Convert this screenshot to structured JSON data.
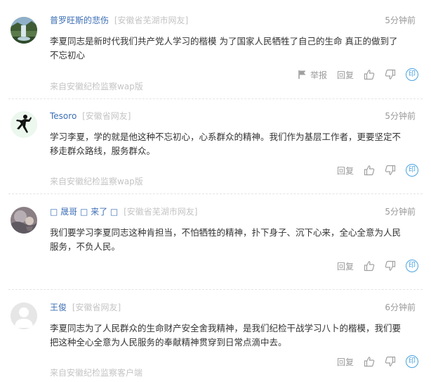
{
  "comments": [
    {
      "username": "普罗旺斯的悲伤",
      "location": "[安徽省芜湖市网友]",
      "time": "5分钟前",
      "lines": [
        "李夏同志是新时代我们共产党人学习的楷模 为了国家人民牺牲了自己的生命 真正的做到了",
        "不忘初心"
      ],
      "report_label": "举报",
      "reply_label": "回复",
      "share_label": "印",
      "source": "来自安徽纪检监察wap版",
      "avatar": "waterfall-landscape"
    },
    {
      "username": "Tesoro",
      "location": "[安徽省网友]",
      "time": "5分钟前",
      "lines": [
        "学习李夏，学的就是他这种不忘初心，心系群众的精神。我们作为基层工作者，更要坚定不",
        "移走群众路线，服务群众。"
      ],
      "reply_label": "回复",
      "share_label": "印",
      "source": "来自安徽纪检监察wap版",
      "avatar": "basketball-silhouette"
    },
    {
      "username": "□ 晟哥 □ 来了 □",
      "location": "[安徽省芜湖市网友]",
      "time": "5分钟前",
      "lines": [
        "我们要学习李夏同志这种肯担当，不怕牺牲的精神，扑下身子、沉下心来，全心全意为人民",
        "服务，不负人民。"
      ],
      "reply_label": "回复",
      "share_label": "印",
      "source": "",
      "avatar": "cartoon-photo"
    },
    {
      "username": "王俊",
      "location": "[安徽省网友]",
      "time": "6分钟前",
      "lines": [
        "李夏同志为了人民群众的生命财产安全舍我精神，是我们纪检干战学习八卜的楷模，我们要",
        "把这种全心全意为人民服务的奉献精神贯穿到日常点滴中去。"
      ],
      "reply_label": "回复",
      "share_label": "印",
      "source": "来自安徽纪检监察客户端",
      "avatar": "default-user"
    }
  ],
  "colors": {
    "username": "#3d6fb6",
    "muted": "#c4c4c4",
    "icon": "#a0a0a0",
    "accent": "#4aa3df"
  }
}
